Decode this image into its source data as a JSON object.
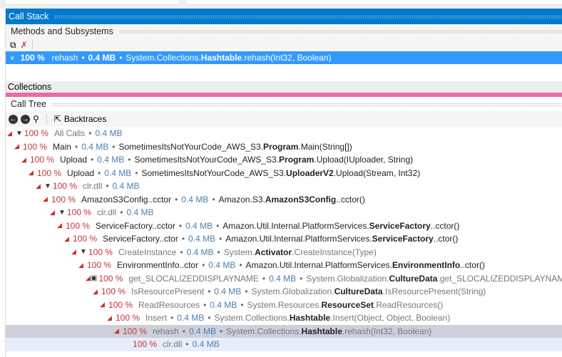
{
  "header": {
    "title": "Call Stack"
  },
  "methods": {
    "title": "Methods and Subsystems"
  },
  "selected": {
    "pct": "100 %",
    "fn": "rehash",
    "size": "0.4 MB",
    "ns": "System.Collections.",
    "cls": "Hashtable",
    "rest": ".rehash(Int32, Boolean)"
  },
  "collections": {
    "title": "Collections"
  },
  "calltree": {
    "title": "Call Tree",
    "backtraces": "Backtraces"
  },
  "rows": [
    {
      "pct": "100 %",
      "fn": "All Calls",
      "size": "0.4 MB",
      "ns": "",
      "cls": "",
      "rest": ""
    },
    {
      "pct": "100 %",
      "fn": "Main",
      "size": "0.4 MB",
      "ns": "SometimesItsNotYourCode_AWS_S3.",
      "cls": "Program",
      "rest": ".Main(String[])"
    },
    {
      "pct": "100 %",
      "fn": "Upload",
      "size": "0.4 MB",
      "ns": "SometimesItsNotYourCode_AWS_S3.",
      "cls": "Program",
      "rest": ".Upload(IUploader, String)"
    },
    {
      "pct": "100 %",
      "fn": "Upload",
      "size": "0.4 MB",
      "ns": "SometimesItsNotYourCode_AWS_S3.",
      "cls": "UploaderV2",
      "rest": ".Upload(Stream, Int32)"
    },
    {
      "pct": "100 %",
      "fn": "clr.dll",
      "size": "0.4 MB",
      "ns": "",
      "cls": "",
      "rest": ""
    },
    {
      "pct": "100 %",
      "fn": "AmazonS3Config..cctor",
      "size": "0.4 MB",
      "ns": "Amazon.S3.",
      "cls": "AmazonS3Config",
      "rest": "..cctor()"
    },
    {
      "pct": "100 %",
      "fn": "clr.dll",
      "size": "0.4 MB",
      "ns": "",
      "cls": "",
      "rest": ""
    },
    {
      "pct": "100 %",
      "fn": "ServiceFactory..cctor",
      "size": "0.4 MB",
      "ns": "Amazon.Util.Internal.PlatformServices.",
      "cls": "ServiceFactory",
      "rest": "..cctor()"
    },
    {
      "pct": "100 %",
      "fn": "ServiceFactory..ctor",
      "size": "0.4 MB",
      "ns": "Amazon.Util.Internal.PlatformServices.",
      "cls": "ServiceFactory",
      "rest": "..ctor()"
    },
    {
      "pct": "100 %",
      "fn": "CreateInstance",
      "size": "0.4 MB",
      "ns": "System.",
      "cls": "Activator",
      "rest": ".CreateInstance(Type)"
    },
    {
      "pct": "100 %",
      "fn": "EnvironmentInfo..ctor",
      "size": "0.4 MB",
      "ns": "Amazon.Util.Internal.PlatformServices.",
      "cls": "EnvironmentInfo",
      "rest": "..ctor()"
    },
    {
      "pct": "100 %",
      "fn": "get_SLOCALIZEDDISPLAYNAME",
      "size": "0.4 MB",
      "ns": "System.Globalization.",
      "cls": "CultureData",
      "rest": ".get_SLOCALIZEDDISPLAYNAME()"
    },
    {
      "pct": "100 %",
      "fn": "IsResourcePresent",
      "size": "0.4 MB",
      "ns": "System.Globalization.",
      "cls": "CultureData",
      "rest": ".IsResourcePresent(String)"
    },
    {
      "pct": "100 %",
      "fn": "ReadResources",
      "size": "0.4 MB",
      "ns": "System.Resources.",
      "cls": "ResourceSet",
      "rest": ".ReadResources()"
    },
    {
      "pct": "100 %",
      "fn": "Insert",
      "size": "0.4 MB",
      "ns": "System.Collections.",
      "cls": "Hashtable",
      "rest": ".Insert(Object, Object, Boolean)"
    },
    {
      "pct": "100 %",
      "fn": "rehash",
      "size": "0.4 MB",
      "ns": "System.Collections.",
      "cls": "Hashtable",
      "rest": ".rehash(Int32, Boolean)"
    },
    {
      "pct": "100 %",
      "fn": "clr.dll",
      "size": "0.4 MB",
      "ns": "",
      "cls": "",
      "rest": ""
    }
  ]
}
